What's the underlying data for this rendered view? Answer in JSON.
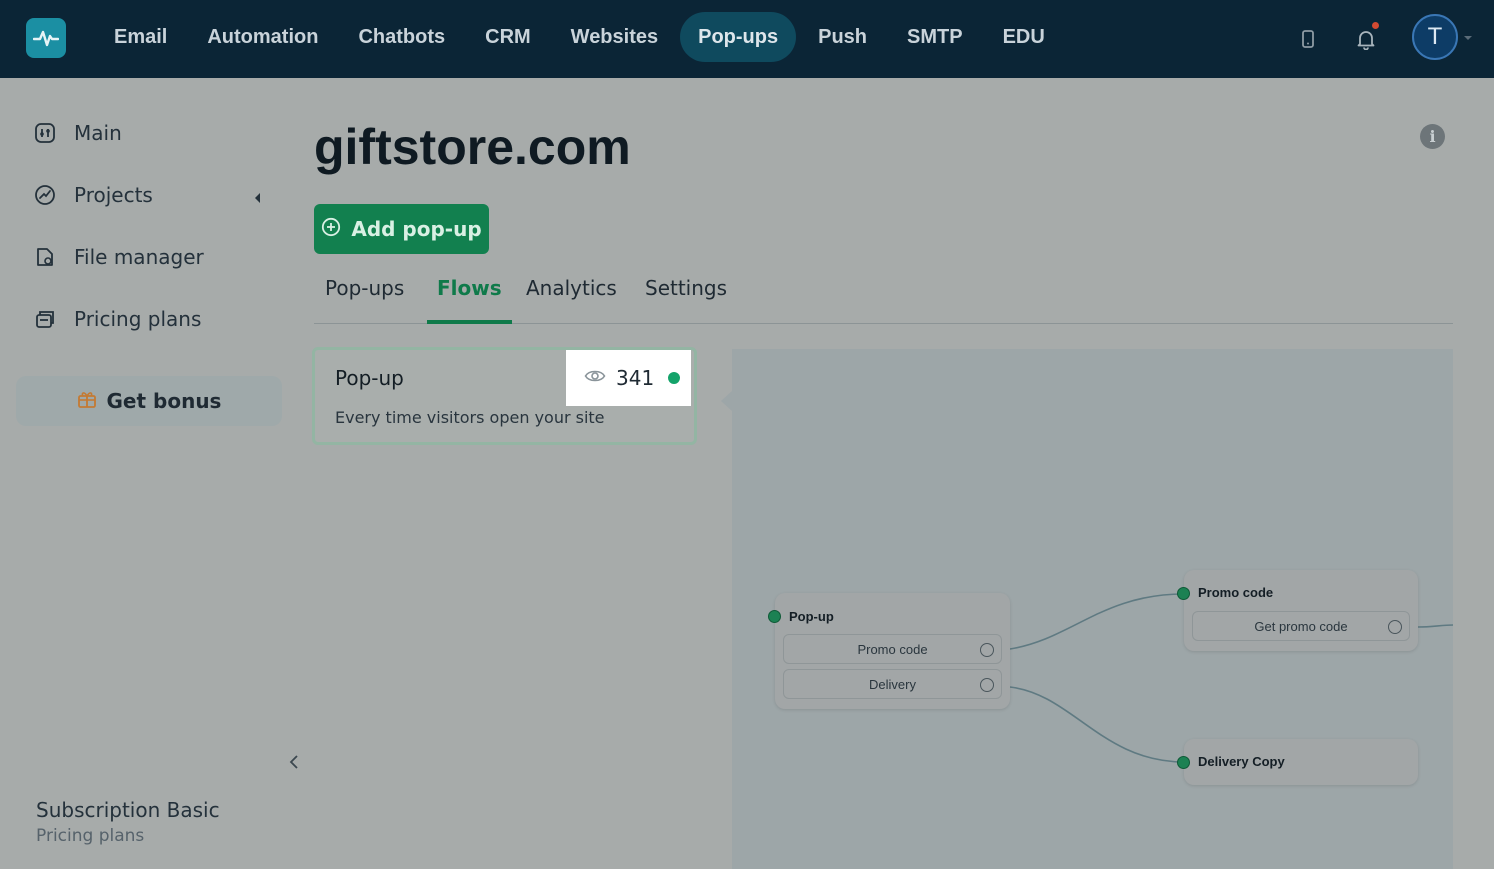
{
  "topnav": {
    "items": [
      "Email",
      "Automation",
      "Chatbots",
      "CRM",
      "Websites",
      "Pop-ups",
      "Push",
      "SMTP",
      "EDU"
    ],
    "active": "Pop-ups",
    "avatar_initial": "T"
  },
  "sidebar": {
    "items": [
      {
        "label": "Main",
        "icon": "dashboard-icon"
      },
      {
        "label": "Projects",
        "icon": "projects-icon"
      },
      {
        "label": "File manager",
        "icon": "file-manager-icon"
      },
      {
        "label": "Pricing plans",
        "icon": "pricing-icon"
      }
    ],
    "bonus_label": "Get bonus",
    "subscription_title": "Subscription Basic",
    "subscription_link": "Pricing plans"
  },
  "main": {
    "title": "giftstore.com",
    "add_button": "Add pop-up",
    "tabs": [
      "Pop-ups",
      "Flows",
      "Analytics",
      "Settings"
    ],
    "active_tab": "Flows"
  },
  "flow_card": {
    "title": "Pop-up",
    "description": "Every time visitors open your site",
    "views": "341",
    "status_color": "#14a36a"
  },
  "flow_canvas": {
    "nodes": [
      {
        "title": "Pop-up",
        "options": [
          "Promo code",
          "Delivery"
        ]
      },
      {
        "title": "Promo code",
        "options": [
          "Get promo code"
        ]
      },
      {
        "title": "Delivery Copy",
        "options": []
      }
    ]
  },
  "colors": {
    "topbar": "#0b2536",
    "accent_green": "#12804f",
    "active_tab": "#0f7a4a"
  }
}
